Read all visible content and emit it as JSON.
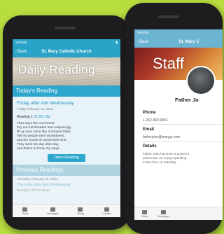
{
  "left_app": {
    "status": {
      "carrier": "Verizon",
      "time": "",
      "battery": ""
    },
    "nav": {
      "back_label": "Back",
      "title": "St. Mary Catholic Church"
    },
    "banner_text": "Daily Reading",
    "section_title": "Today's Reading",
    "reading": {
      "heading": "Friday after Ash Wednesday",
      "date": "Friday, February 16, 2018",
      "label": "Reading 1",
      "reference": "IS 58:1-9a",
      "text_lines": [
        "Thus says the Lord GOD:",
        "Cry out full-throated and unsparingly,",
        "lift up your voice like a trumpet blast;",
        "Tell my people their wickedness,",
        "and the house of Jacob their sins.",
        "They seek me day after day,",
        "and desire to know my ways,"
      ],
      "button_label": "Open Reading"
    },
    "previous": {
      "title": "Previous Readings",
      "date": "Thursday, February 15, 2018",
      "heading": "Thursday after Ash Wednesday",
      "snippet": "Reading 1 DT 30:15-20"
    },
    "tabs": [
      {
        "label": "Home",
        "icon": "home-icon"
      },
      {
        "label": "Messages",
        "icon": "messages-icon"
      },
      {
        "label": "Giving",
        "icon": "giving-icon"
      },
      {
        "label": "Contact",
        "icon": "contact-icon"
      }
    ]
  },
  "right_app": {
    "status": {
      "carrier": "Verizon"
    },
    "nav": {
      "back_label": "Back",
      "title": "St. Mary C"
    },
    "banner_text": "Staff",
    "person_name": "Father Jo",
    "phone_label": "Phone",
    "phone_value": "1-262-960-9952",
    "email_label": "Email",
    "email_value": "fatherjohn@maryjp.com",
    "details_label": "Details",
    "details_lines": [
      "Father John has been a priest for",
      "years now. He enjoys spending",
      "in the choir on Saturday"
    ],
    "tabs": [
      {
        "label": "Home",
        "icon": "home-icon"
      },
      {
        "label": "Messages",
        "icon": "messages-icon"
      }
    ]
  },
  "colors": {
    "background": "#b8dd3f",
    "accent": "#2ea7cf",
    "phone_body": "#1d1d1f"
  }
}
